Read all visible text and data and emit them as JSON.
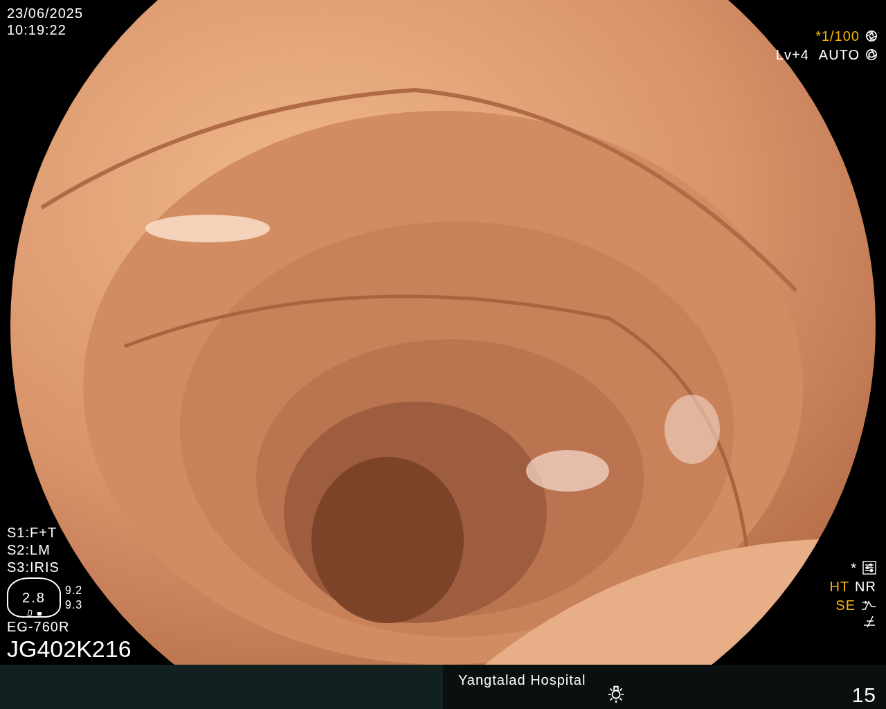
{
  "datetime": {
    "date": "23/06/2025",
    "time": "10:19:22"
  },
  "shutter": {
    "text": "*1/100",
    "active": true
  },
  "light": {
    "level_text": "Lv+4",
    "mode": "AUTO"
  },
  "switches": [
    "S1:F+T",
    "S2:LM",
    "S3:IRIS"
  ],
  "zoom_gauge": {
    "value": "2.8",
    "readings": [
      "9.2",
      "9.3"
    ]
  },
  "scope": {
    "model": "EG-760R",
    "serial": "JG402K216"
  },
  "settings_mark": "*",
  "enhancement_rows": [
    {
      "items": [
        {
          "label": "HT",
          "active": true
        },
        {
          "label": "NR",
          "active": false
        }
      ]
    },
    {
      "items": [
        {
          "label": "SE",
          "active": true
        }
      ]
    }
  ],
  "footer": {
    "hospital": "Yangtalad Hospital",
    "number": "15"
  }
}
